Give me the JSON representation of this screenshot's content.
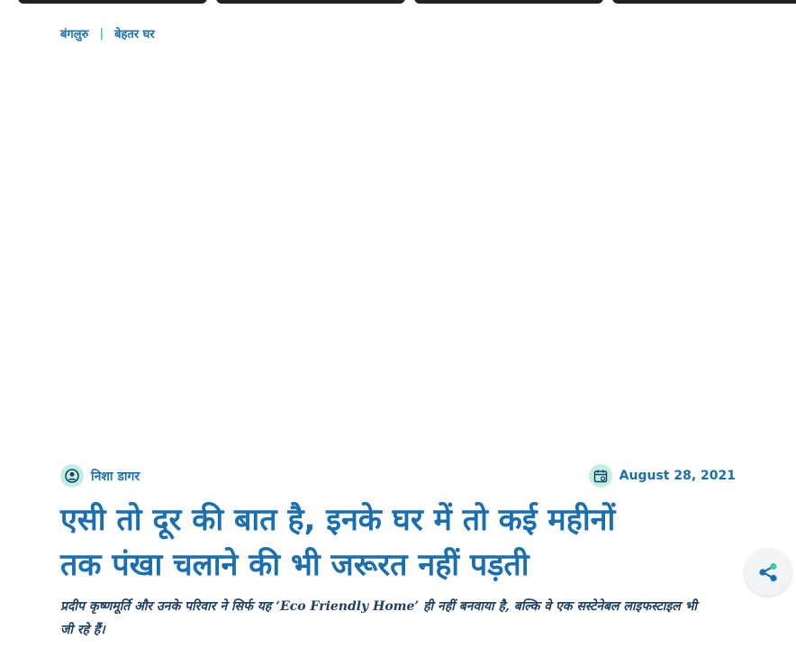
{
  "breadcrumb": {
    "city": "बंगलुरु",
    "separator": "|",
    "category": "बेहतर घर"
  },
  "article": {
    "author": "निशा डागर",
    "date": "August 28, 2021",
    "headline_line1": "एसी तो दूर की बात है, इनके घर में तो कई महीनों",
    "headline_line2": "तक पंखा चलाने की भी जरूरत नहीं पड़ती",
    "summary": "प्रदीप कृष्णमूर्ति और उनके परिवार ने सिर्फ यह ‘Eco Friendly Home’ ही नहीं बनवाया है, बल्कि वे एक सस्टेनेबल लाइफस्टाइल भी जी रहे हैं।"
  },
  "icons": {
    "author": "user-circle-icon",
    "date": "calendar-icon",
    "share": "share-icon"
  },
  "colors": {
    "primary": "#1a6fb0",
    "accent": "#3ec8b0",
    "icon_bg": "#bff0e2",
    "text_dark": "#1f3f63"
  }
}
